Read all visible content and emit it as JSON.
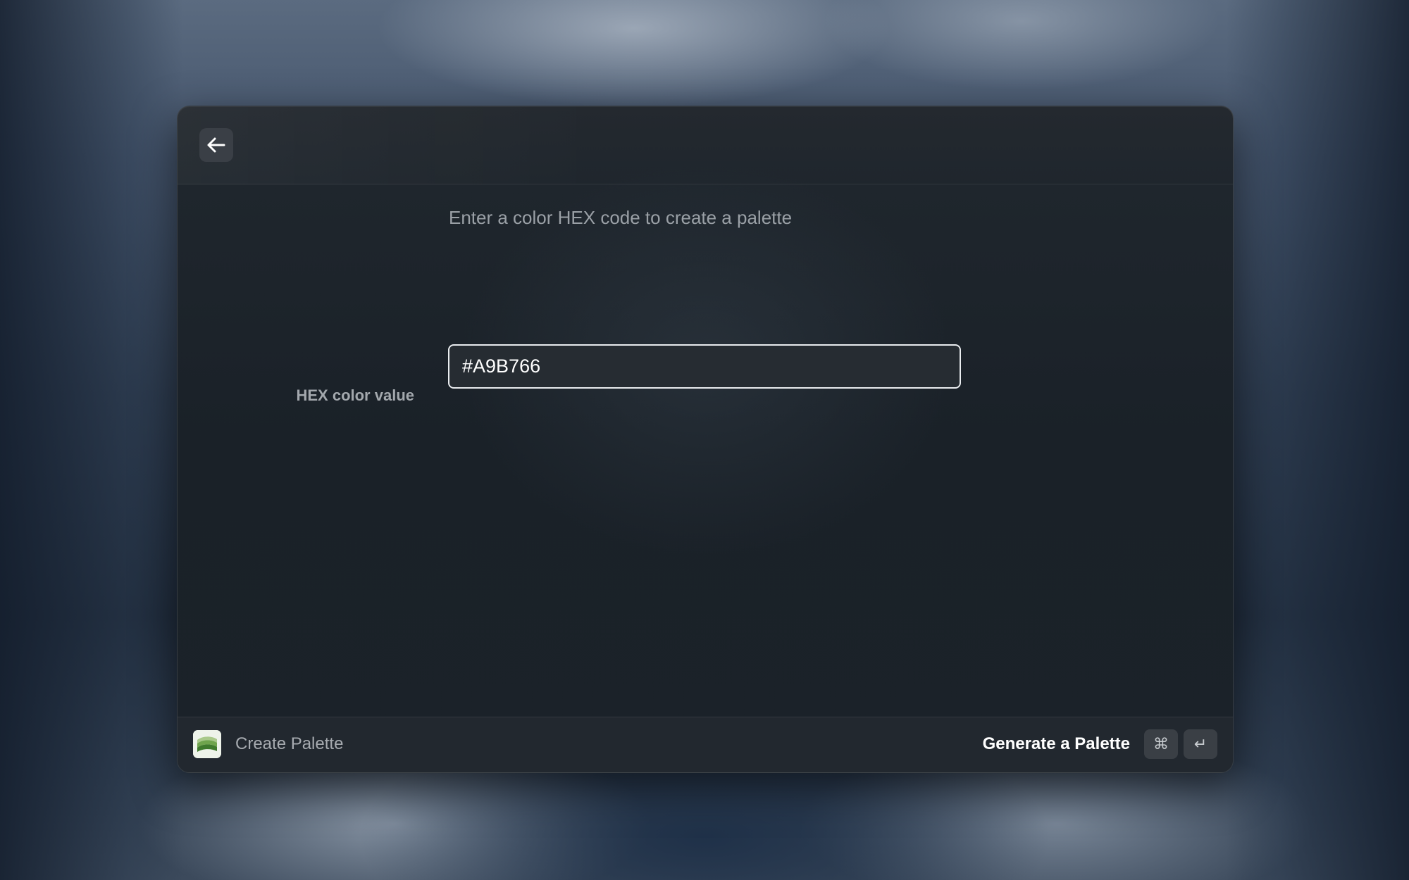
{
  "window": {
    "back_icon": "arrow-left-icon"
  },
  "form": {
    "hint": "Enter a color HEX code to create a palette",
    "hex_label": "HEX color value",
    "hex_value": "#A9B766",
    "hex_placeholder": ""
  },
  "footer": {
    "app_icon": "palette-app-icon",
    "app_name": "Create Palette",
    "action_label": "Generate a Palette",
    "shortcut": [
      "⌘",
      "↵"
    ]
  },
  "colors": {
    "window_bg": "#1b2229",
    "input_border": "#e9ecef",
    "text_primary": "#ffffff",
    "text_secondary": "#9aa0a6",
    "app_icon_green": "#5a8f3c"
  }
}
